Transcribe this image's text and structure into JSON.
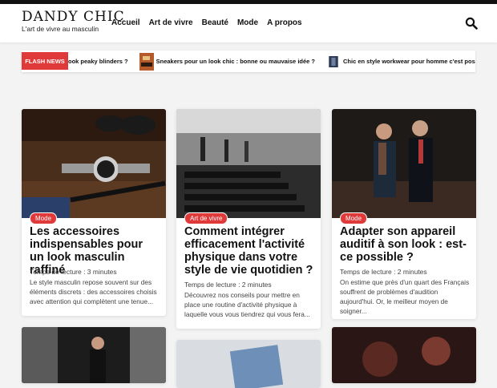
{
  "site": {
    "logo_title": "DANDY CHIC",
    "logo_tagline": "L'art de vivre au masculin"
  },
  "nav": {
    "items": [
      "Accueil",
      "Art de vivre",
      "Beauté",
      "Mode",
      "A propos"
    ]
  },
  "flash": {
    "label": "FLASH NEWS",
    "items": [
      "ook peaky blinders ?",
      "Sneakers pour un look chic : bonne ou mauvaise idée ?",
      "Chic en style workwear pour homme c'est possible ?"
    ]
  },
  "articles": [
    {
      "tag": "Mode",
      "title": "Les accessoires indispensables pour un look masculin raffiné",
      "reading_time": "Temps de lecture : 3 minutes",
      "excerpt": "Le style masculin repose souvent sur des éléments discrets : des accessoires choisis avec attention qui complètent une tenue..."
    },
    {
      "tag": "Art de vivre",
      "title": "Comment intégrer efficacement l'activité physique dans votre style de vie quotidien ?",
      "reading_time": "Temps de lecture : 2 minutes",
      "excerpt": "Découvrez nos conseils pour mettre en place une routine d'activité physique à laquelle vous vous tiendrez qui vous fera..."
    },
    {
      "tag": "Mode",
      "title": "Adapter son appareil auditif à son look : est-ce possible ?",
      "reading_time": "Temps de lecture : 2 minutes",
      "excerpt": "On estime que près d'un quart des Français souffrent de problèmes d'audition aujourd'hui. Or, le meilleur moyen de soigner..."
    }
  ],
  "colors": {
    "accent": "#e0393a",
    "text": "#111111",
    "background": "#f3f3f3"
  },
  "icons": {
    "search": "search-icon"
  }
}
